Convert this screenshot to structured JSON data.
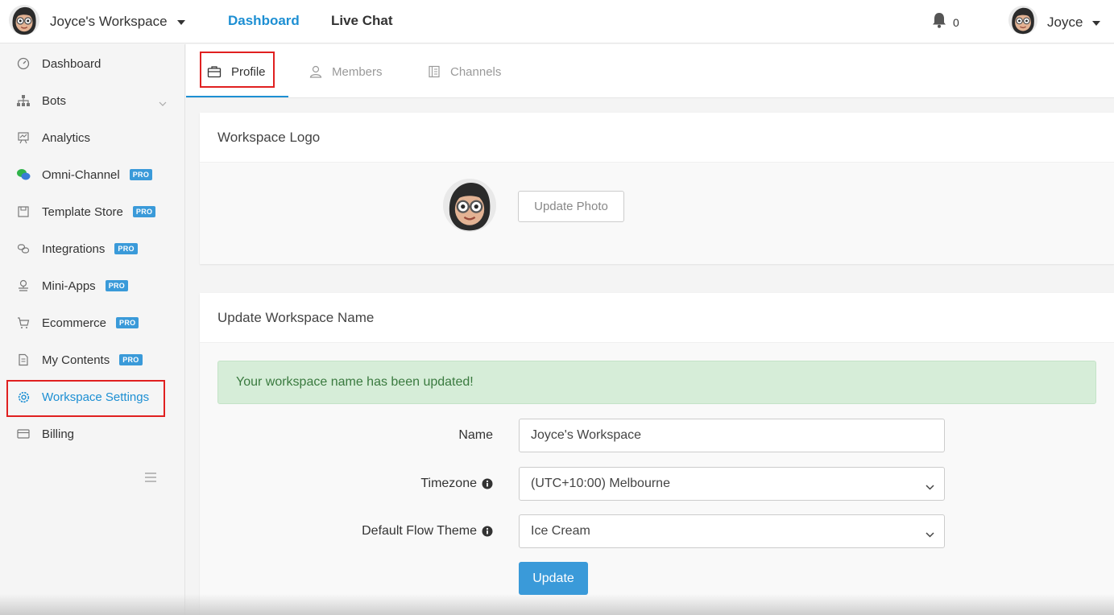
{
  "topbar": {
    "workspace_name": "Joyce's Workspace",
    "nav_dashboard": "Dashboard",
    "nav_live_chat": "Live Chat",
    "notification_count": "0",
    "user_name": "Joyce"
  },
  "sidebar": {
    "items": [
      {
        "label": "Dashboard",
        "icon": "gauge-icon",
        "pro": ""
      },
      {
        "label": "Bots",
        "icon": "sitemap-icon",
        "pro": ""
      },
      {
        "label": "Analytics",
        "icon": "presentation-icon",
        "pro": ""
      },
      {
        "label": "Omni-Channel",
        "icon": "chat-bubbles-icon",
        "pro": "PRO"
      },
      {
        "label": "Template Store",
        "icon": "store-icon",
        "pro": "PRO"
      },
      {
        "label": "Integrations",
        "icon": "link-icon",
        "pro": "PRO"
      },
      {
        "label": "Mini-Apps",
        "icon": "stamp-icon",
        "pro": "PRO"
      },
      {
        "label": "Ecommerce",
        "icon": "cart-icon",
        "pro": "PRO"
      },
      {
        "label": "My Contents",
        "icon": "document-icon",
        "pro": "PRO"
      },
      {
        "label": "Workspace Settings",
        "icon": "gear-icon",
        "pro": ""
      },
      {
        "label": "Billing",
        "icon": "credit-card-icon",
        "pro": ""
      }
    ]
  },
  "tabs": [
    {
      "label": "Profile",
      "icon": "briefcase-icon"
    },
    {
      "label": "Members",
      "icon": "user-icon"
    },
    {
      "label": "Channels",
      "icon": "list-icon"
    }
  ],
  "logo_card": {
    "title": "Workspace Logo",
    "update_photo": "Update Photo"
  },
  "name_card": {
    "title": "Update Workspace Name",
    "alert": "Your workspace name has been updated!",
    "name_label": "Name",
    "name_value": "Joyce's Workspace",
    "timezone_label": "Timezone",
    "timezone_value": "(UTC+10:00) Melbourne",
    "theme_label": "Default Flow Theme",
    "theme_value": "Ice Cream",
    "update_button": "Update"
  },
  "colors": {
    "accent": "#1d8fd3",
    "primary_button": "#3a9ad9",
    "success_bg": "#d6edd8",
    "highlight": "#e02020"
  }
}
